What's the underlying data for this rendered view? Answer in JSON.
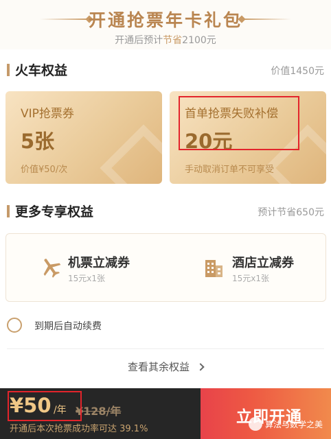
{
  "header": {
    "title": "开通抢票年卡礼包",
    "subtitle_prefix": "开通后预计",
    "subtitle_highlight": "节省",
    "subtitle_amount": "2100元"
  },
  "train_section": {
    "title": "火车权益",
    "value": "价值1450元",
    "cards": [
      {
        "label": "VIP抢票券",
        "value": "5张",
        "note": "价值¥50/次"
      },
      {
        "label": "首单抢票失败补偿",
        "value": "20元",
        "note": "手动取消订单不可享受"
      }
    ]
  },
  "more_section": {
    "title": "更多专享权益",
    "value": "预计节省650元",
    "benefits": [
      {
        "name": "机票立减券",
        "desc": "15元x1张",
        "icon": "airplane-icon"
      },
      {
        "name": "酒店立减券",
        "desc": "15元x1张",
        "icon": "hotel-icon"
      }
    ]
  },
  "auto_renew": {
    "label": "到期后自动续费",
    "checked": false
  },
  "view_more": {
    "label": "查看其余权益"
  },
  "bottom": {
    "price": "¥50",
    "price_unit": "/年",
    "original_price": "¥128/年",
    "note": "开通后本次抢票成功率可达 39.1%",
    "cta_label": "立即开通",
    "watermark": "算法与数学之美"
  },
  "colors": {
    "gold": "#c99a65",
    "card_gradient_start": "#f8e3c2",
    "card_gradient_end": "#dfb57c",
    "cta_start": "#e8434a",
    "cta_end": "#f18a4c",
    "bar_bg": "#262626",
    "annotation_red": "#e3242b"
  }
}
